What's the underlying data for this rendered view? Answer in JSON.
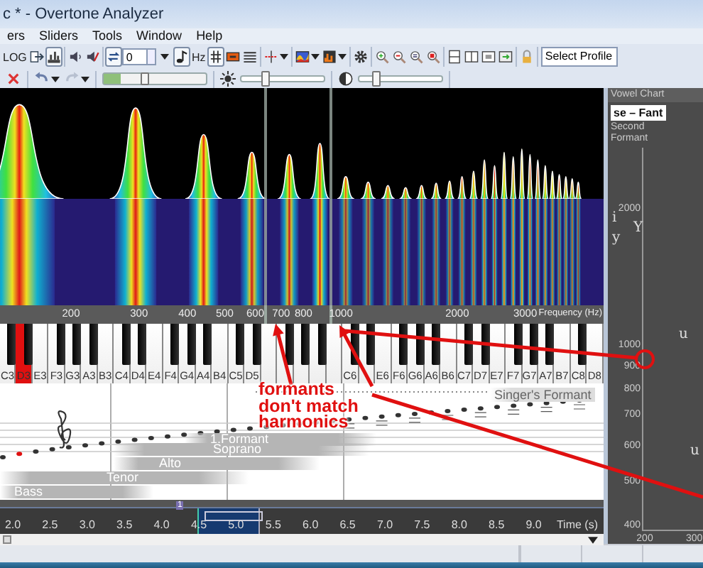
{
  "window": {
    "title": "c * - Overtone Analyzer"
  },
  "menu": [
    {
      "label": "ers"
    },
    {
      "label": "Sliders"
    },
    {
      "label": "Tools"
    },
    {
      "label": "Window"
    },
    {
      "label": "Help"
    }
  ],
  "main_toolbar": {
    "groups": [
      [
        {
          "kind": "text",
          "label": "LOG",
          "pressed": false
        },
        {
          "kind": "export",
          "pressed": false
        },
        {
          "kind": "spectrum",
          "pressed": true
        }
      ],
      [
        {
          "kind": "speaker",
          "pressed": false
        },
        {
          "kind": "mute",
          "pressed": false
        }
      ],
      [
        {
          "kind": "loop",
          "pressed": true
        },
        {
          "kind": "spinner",
          "value": "0"
        },
        {
          "kind": "dropdown",
          "pressed": false
        },
        {
          "kind": "note",
          "pressed": true
        },
        {
          "kind": "text",
          "label": "Hz",
          "pressed": false
        },
        {
          "kind": "sharp",
          "pressed": true
        },
        {
          "kind": "record",
          "pressed": false
        },
        {
          "kind": "list",
          "pressed": false
        }
      ],
      [
        {
          "kind": "split",
          "pressed": false
        }
      ],
      [
        {
          "kind": "palette",
          "pressed": false
        },
        {
          "kind": "chart",
          "pressed": false
        }
      ],
      [
        {
          "kind": "gear",
          "pressed": false
        }
      ],
      [
        {
          "kind": "zoom_in",
          "pressed": false
        },
        {
          "kind": "zoom_out",
          "pressed": false
        },
        {
          "kind": "zoom_fit",
          "pressed": false
        },
        {
          "kind": "zoom_reset",
          "pressed": false
        }
      ],
      [
        {
          "kind": "rows",
          "pressed": false
        },
        {
          "kind": "cols",
          "pressed": false
        },
        {
          "kind": "panel",
          "pressed": false
        },
        {
          "kind": "insert",
          "pressed": false
        }
      ],
      [
        {
          "kind": "lock",
          "pressed": false
        }
      ],
      [
        {
          "kind": "select",
          "value": "Select Profile"
        }
      ]
    ]
  },
  "view_toolbar": {
    "groups": [
      [
        {
          "kind": "close"
        }
      ],
      [
        {
          "kind": "undo"
        },
        {
          "kind": "redo"
        }
      ],
      [
        {
          "kind": "volume",
          "level": 0.4,
          "meter": {
            "level": 0.17
          }
        }
      ],
      [
        {
          "kind": "brightness",
          "level": 0.3
        }
      ],
      [
        {
          "kind": "contrast",
          "level": 0.2
        }
      ]
    ]
  },
  "frequency_axis": {
    "ticks": [
      "200",
      "300",
      "400",
      "500",
      "600",
      "700",
      "800",
      "1000",
      "2000",
      "3000"
    ],
    "label": "Frequency (Hz)"
  },
  "piano": {
    "keys": [
      {
        "label": "C3",
        "selected": false
      },
      {
        "label": "D3",
        "selected": true
      },
      {
        "label": "E3",
        "selected": false
      },
      {
        "label": "F3",
        "selected": false
      },
      {
        "label": "G3",
        "selected": false
      },
      {
        "label": "A3",
        "selected": false
      },
      {
        "label": "B3",
        "selected": false
      },
      {
        "label": "C4",
        "selected": false
      },
      {
        "label": "D4",
        "selected": false
      },
      {
        "label": "E4",
        "selected": false
      },
      {
        "label": "F4",
        "selected": false
      },
      {
        "label": "G4",
        "selected": false
      },
      {
        "label": "A4",
        "selected": false
      },
      {
        "label": "B4",
        "selected": false
      },
      {
        "label": "C5",
        "selected": false
      },
      {
        "label": "D5",
        "selected": false
      },
      {
        "selected": false
      },
      {
        "selected": false
      },
      {
        "selected": false
      },
      {
        "selected": false
      },
      {
        "selected": false
      },
      {
        "label": "C6",
        "selected": false
      },
      {
        "selected": false
      },
      {
        "label": "E6",
        "selected": false
      },
      {
        "label": "F6",
        "selected": false
      },
      {
        "label": "G6",
        "selected": false
      },
      {
        "label": "A6",
        "selected": false
      },
      {
        "label": "B6",
        "selected": false
      },
      {
        "label": "C7",
        "selected": false
      },
      {
        "label": "D7",
        "selected": false
      },
      {
        "label": "E7",
        "selected": false
      },
      {
        "label": "F7",
        "selected": false
      },
      {
        "label": "G7",
        "selected": false
      },
      {
        "label": "A7",
        "selected": false
      },
      {
        "label": "B7",
        "selected": false
      },
      {
        "label": "C8",
        "selected": false
      },
      {
        "label": "D8",
        "selected": false
      }
    ]
  },
  "staff": {
    "singers_formant": "Singer's Formant",
    "bands": [
      {
        "label": "1.Formant"
      },
      {
        "label": "Soprano"
      },
      {
        "label": "Alto"
      },
      {
        "label": "Tenor"
      },
      {
        "label": "Bass"
      }
    ]
  },
  "timeline": {
    "marker": "1",
    "ticks": [
      "2.0",
      "2.5",
      "3.0",
      "3.5",
      "4.0",
      "4.5",
      "5.0",
      "5.5",
      "6.0",
      "6.5",
      "7.0",
      "7.5",
      "8.0",
      "8.5",
      "9.0"
    ],
    "label": "Time (s)"
  },
  "vowel_chart": {
    "title": "Vowel Chart",
    "header": "se – Fant",
    "axis_title": "Second Formant",
    "y_ticks": [
      "2000",
      "1000",
      "900",
      "800",
      "700",
      "600",
      "500",
      "400"
    ],
    "x_ticks": [
      "200",
      "300"
    ],
    "vowels": [
      {
        "symbol": "i"
      },
      {
        "symbol": "y"
      },
      {
        "symbol": "Y"
      },
      {
        "symbol": "u"
      },
      {
        "symbol": "u"
      }
    ]
  },
  "annotation": {
    "text": "formants don't match harmonics"
  }
}
